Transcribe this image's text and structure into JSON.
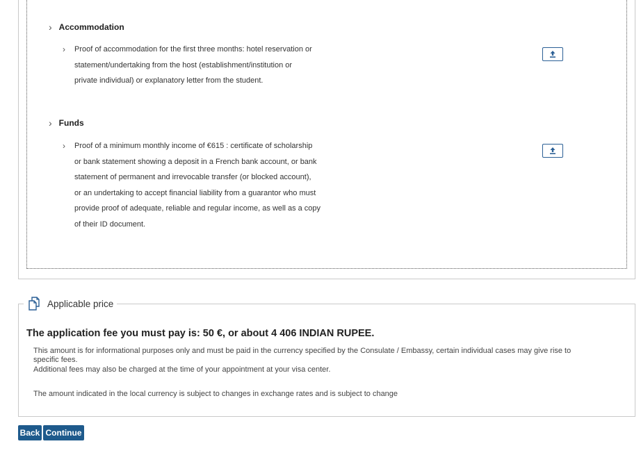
{
  "documents": {
    "accommodation": {
      "title": "Accommodation",
      "items": [
        {
          "lines": [
            "Proof of accommodation for the first three months: hotel reservation or",
            "statement/undertaking from the host (establishment/institution or",
            "private individual) or explanatory letter from the student."
          ]
        }
      ]
    },
    "funds": {
      "title": "Funds",
      "items": [
        {
          "lines": [
            "Proof of a minimum monthly income of €615 : certificate of scholarship",
            "or bank statement showing a deposit in a French bank account, or bank",
            "statement of permanent and irrevocable transfer (or blocked account),",
            "or an undertaking to accept financial liability from a guarantor who must",
            "provide proof of adequate, reliable and regular income, as well as a copy",
            "of their ID document."
          ]
        }
      ]
    }
  },
  "price": {
    "legend": "Applicable price",
    "headline": "The application fee you must pay is: 50 €, or about 4 406 INDIAN RUPEE.",
    "info_line1": "This amount is for informational purposes only and must be paid in the currency specified by the Consulate / Embassy, certain individual cases may give rise to",
    "info_line2": "specific fees.",
    "info_line3": "Additional fees may also be charged at the time of your appointment at your visa center.",
    "exchange_note": "The amount indicated in the local currency is subject to changes in exchange rates and is subject to change"
  },
  "actions": {
    "back": "Back",
    "continue": "Continue"
  },
  "colors": {
    "primary_button": "#1e5a8c",
    "upload_border": "#2a5f95"
  },
  "icons": {
    "section_chevron": "chevron-right-icon",
    "upload": "upload-icon",
    "price_legend": "copy-documents-icon"
  }
}
